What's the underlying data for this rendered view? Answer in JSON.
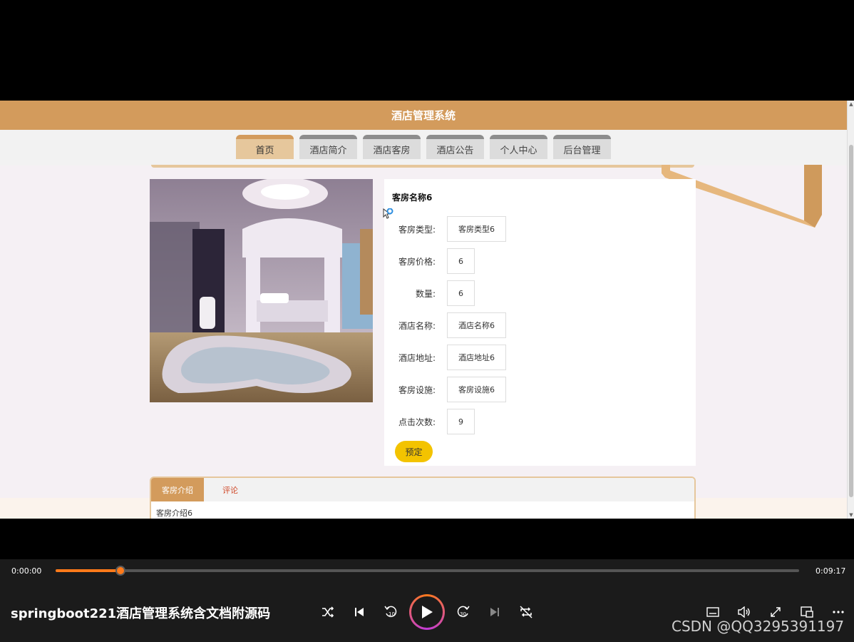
{
  "site": {
    "title": "酒店管理系统",
    "nav": [
      {
        "label": "首页",
        "active": true
      },
      {
        "label": "酒店简介",
        "active": false
      },
      {
        "label": "酒店客房",
        "active": false
      },
      {
        "label": "酒店公告",
        "active": false
      },
      {
        "label": "个人中心",
        "active": false
      },
      {
        "label": "后台管理",
        "active": false
      }
    ]
  },
  "room": {
    "name": "客房名称6",
    "fields": [
      {
        "label": "客房类型:",
        "value": "客房类型6"
      },
      {
        "label": "客房价格:",
        "value": "6"
      },
      {
        "label": "数量:",
        "value": "6"
      },
      {
        "label": "酒店名称:",
        "value": "酒店名称6"
      },
      {
        "label": "酒店地址:",
        "value": "酒店地址6"
      },
      {
        "label": "客房设施:",
        "value": "客房设施6"
      },
      {
        "label": "点击次数:",
        "value": "9"
      }
    ],
    "book_label": "预定"
  },
  "tabs": {
    "items": [
      {
        "label": "客房介绍",
        "active": true
      },
      {
        "label": "评论",
        "active": false
      }
    ],
    "content": "客房介绍6"
  },
  "player": {
    "current_time": "0:00:00",
    "total_time": "0:09:17",
    "progress": 0.087,
    "video_title": "springboot221酒店管理系统含文档附源码",
    "watermark": "CSDN @QQ3295391197",
    "accent": "#ff7a1a"
  }
}
